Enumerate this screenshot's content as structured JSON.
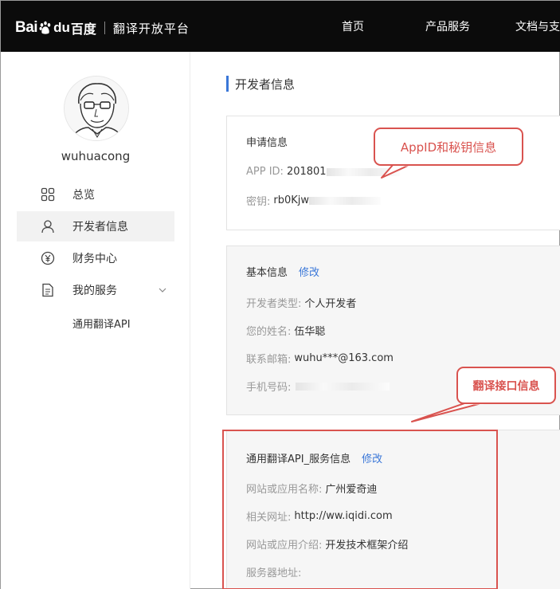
{
  "header": {
    "logo_bai": "Bai",
    "logo_du": "du",
    "logo_baidu_cn": "百度",
    "platform_name": "翻译开放平台",
    "nav": [
      "首页",
      "产品服务",
      "文档与支"
    ]
  },
  "sidebar": {
    "username": "wuhuacong",
    "items": [
      {
        "label": "总览",
        "icon": "grid-icon"
      },
      {
        "label": "开发者信息",
        "icon": "user-icon"
      },
      {
        "label": "财务中心",
        "icon": "yen-icon"
      },
      {
        "label": "我的服务",
        "icon": "document-icon"
      }
    ],
    "subitems": [
      "通用翻译API"
    ]
  },
  "page": {
    "title": "开发者信息"
  },
  "app_info": {
    "title": "申请信息",
    "app_id_label": "APP ID:",
    "app_id_value": "201801",
    "key_label": "密钥:",
    "key_value": "rb0Kjw"
  },
  "basic_info": {
    "title": "基本信息",
    "edit": "修改",
    "type_label": "开发者类型:",
    "type_value": "个人开发者",
    "name_label": "您的姓名:",
    "name_value": "伍华聪",
    "email_label": "联系邮箱:",
    "email_value": "wuhu***@163.com",
    "phone_label": "手机号码:",
    "phone_value": ""
  },
  "service_info": {
    "title": "通用翻译API_服务信息",
    "edit": "修改",
    "site_name_label": "网站或应用名称:",
    "site_name_value": "广州爱奇迪",
    "url_label": "相关网址:",
    "url_value": "http://ww.iqidi.com",
    "intro_label": "网站或应用介绍:",
    "intro_value": "开发技术框架介绍",
    "server_label": "服务器地址:",
    "server_value": ""
  },
  "annotations": {
    "callout_appid": "AppID和秘钥信息",
    "callout_translate": "翻译接口信息"
  },
  "colors": {
    "topbar": "#0b0b0b",
    "accent": "#3a77d8",
    "annotation": "#d9534f"
  }
}
